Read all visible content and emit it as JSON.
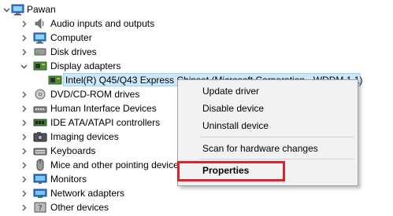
{
  "root": {
    "label": "Pawan"
  },
  "categories": [
    {
      "id": "audio",
      "label": "Audio inputs and outputs",
      "icon": "speaker-icon"
    },
    {
      "id": "computer",
      "label": "Computer",
      "icon": "computer-icon"
    },
    {
      "id": "disk",
      "label": "Disk drives",
      "icon": "disk-drive-icon"
    },
    {
      "id": "display",
      "label": "Display adapters",
      "icon": "display-adapter-icon",
      "expanded": true
    },
    {
      "id": "intel",
      "label": "Intel(R) Q45/Q43 Express Chipset (Microsoft Corporation - WDDM 1.1)",
      "icon": "display-adapter-icon",
      "child": true,
      "selected": true
    },
    {
      "id": "dvd",
      "label": "DVD/CD-ROM drives",
      "icon": "dvd-drive-icon"
    },
    {
      "id": "hid",
      "label": "Human Interface Devices",
      "icon": "hid-icon"
    },
    {
      "id": "ide",
      "label": "IDE ATA/ATAPI controllers",
      "icon": "ide-controller-icon"
    },
    {
      "id": "imaging",
      "label": "Imaging devices",
      "icon": "camera-icon"
    },
    {
      "id": "keyboards",
      "label": "Keyboards",
      "icon": "keyboard-icon"
    },
    {
      "id": "mice",
      "label": "Mice and other pointing devices",
      "icon": "mouse-icon"
    },
    {
      "id": "monitors",
      "label": "Monitors",
      "icon": "monitor-icon"
    },
    {
      "id": "network",
      "label": "Network adapters",
      "icon": "network-adapter-icon"
    },
    {
      "id": "other",
      "label": "Other devices",
      "icon": "unknown-device-icon"
    }
  ],
  "context_menu": {
    "update_driver": "Update driver",
    "disable_device": "Disable device",
    "uninstall_device": "Uninstall device",
    "scan_changes": "Scan for hardware changes",
    "properties": "Properties"
  },
  "colors": {
    "selection_bg": "#cce8ff",
    "highlight_border": "#e0202a"
  }
}
